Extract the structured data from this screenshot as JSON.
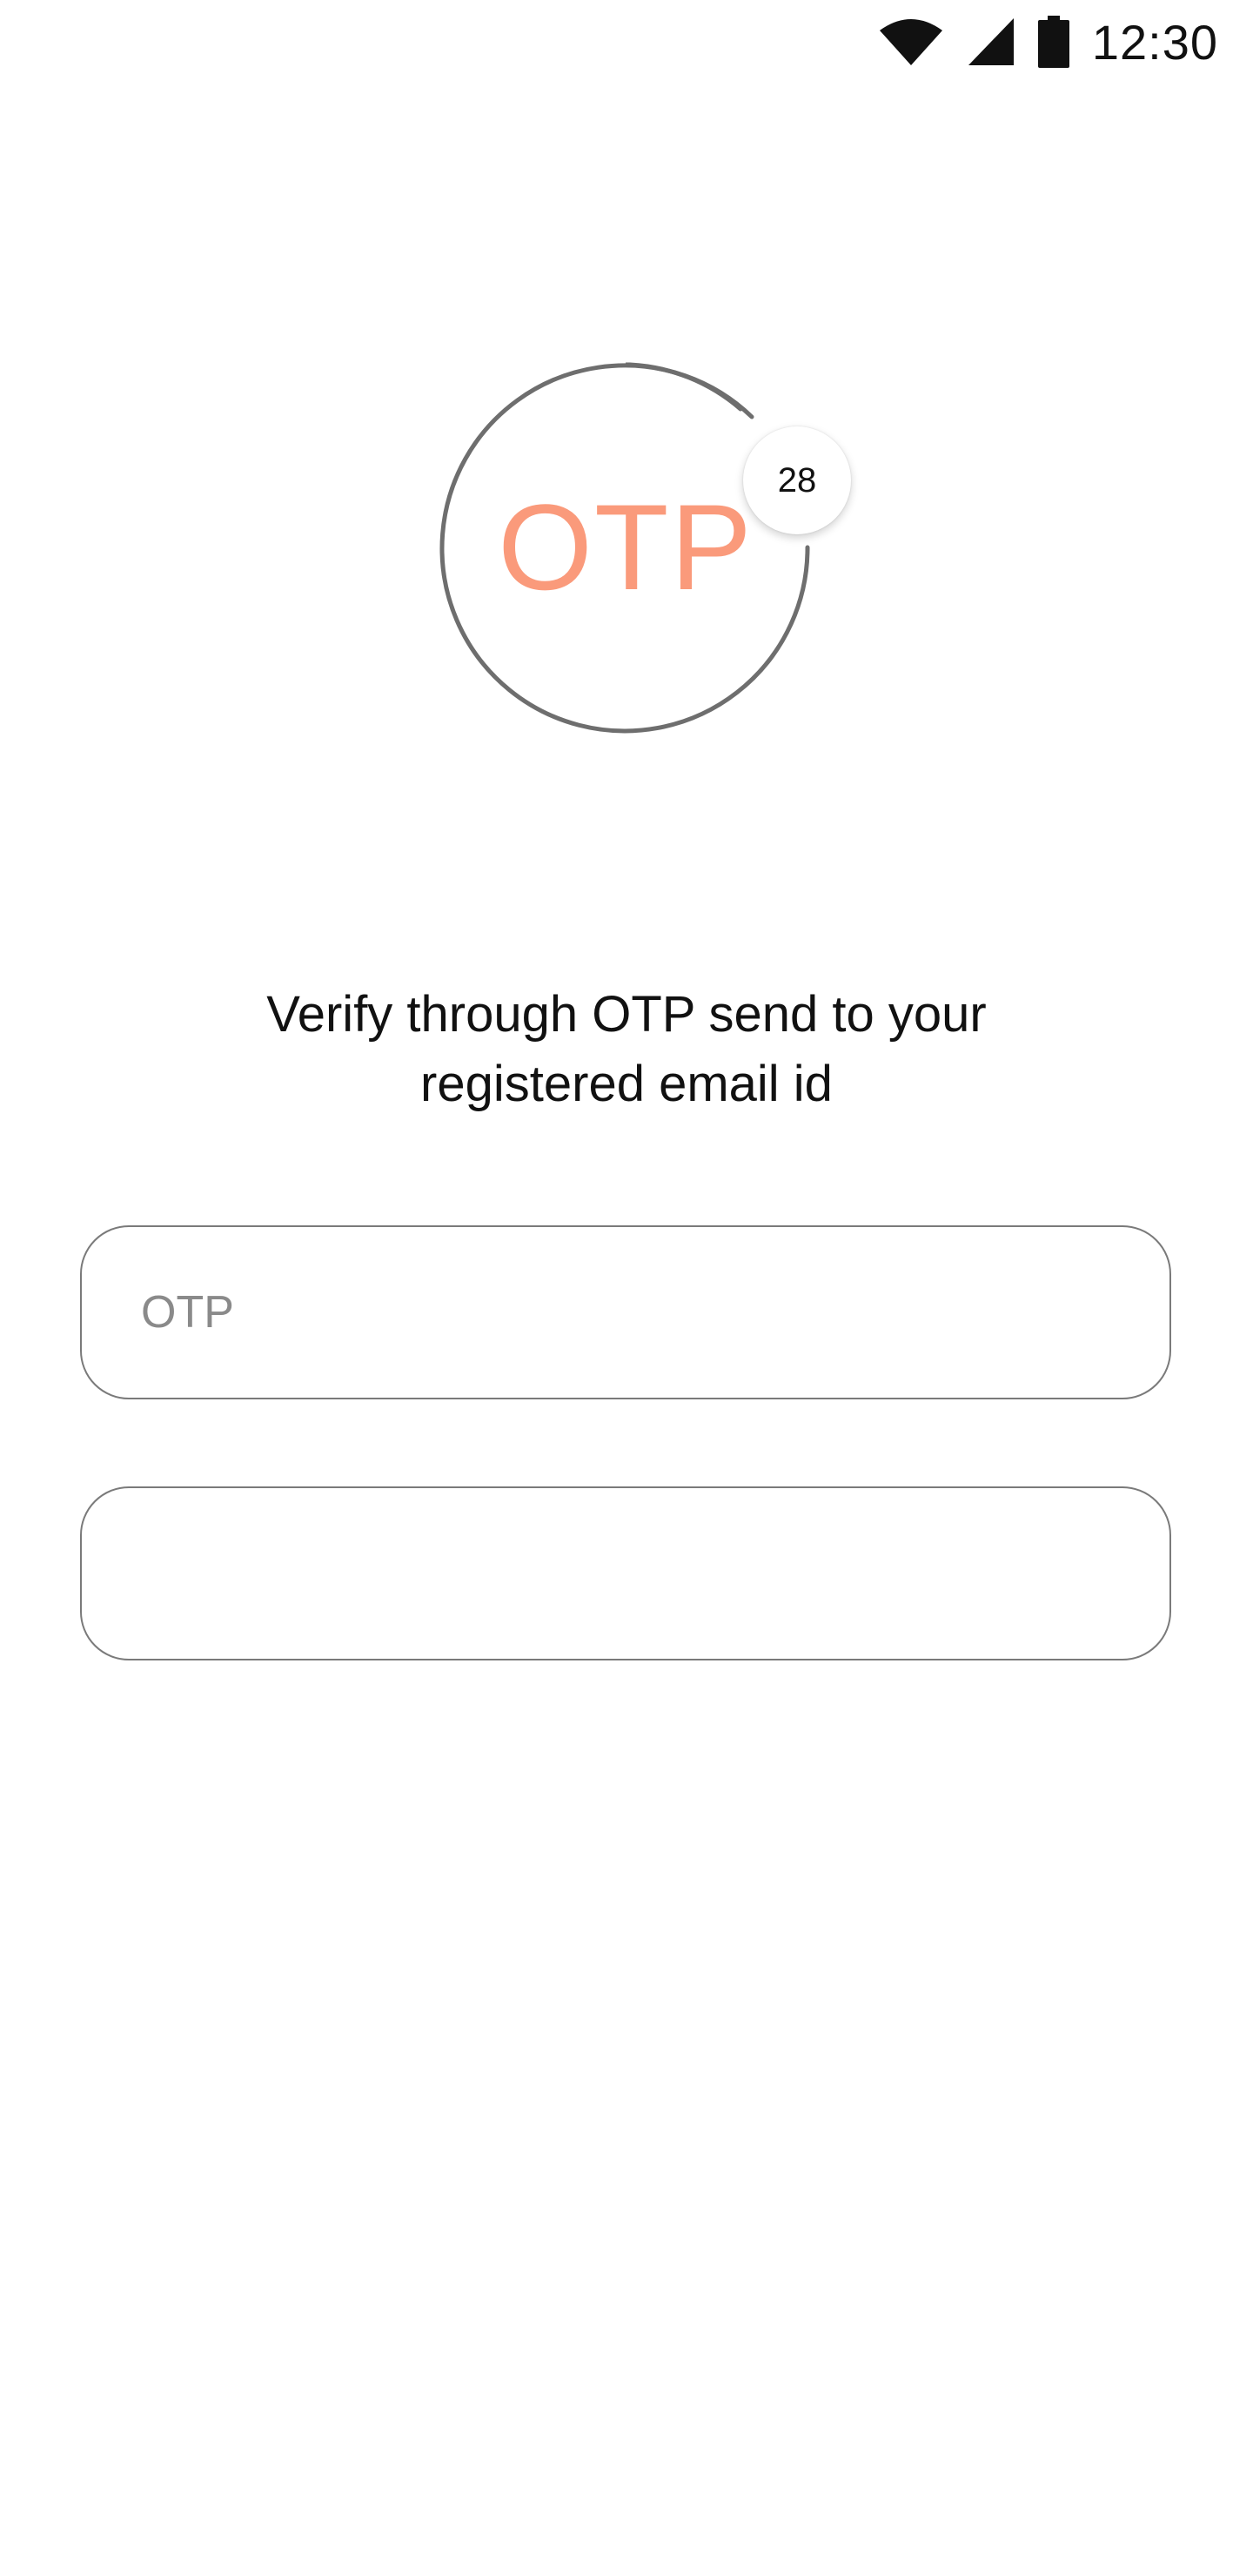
{
  "status_bar": {
    "time": "12:30",
    "icons": [
      "wifi-icon",
      "cellular-signal-icon",
      "battery-icon"
    ]
  },
  "otp_badge": {
    "label": "OTP",
    "timer_seconds": "28",
    "label_color": "#fa9a7b",
    "ring_color": "#6e6e6e"
  },
  "instruction": {
    "line1": "Verify through OTP send to your",
    "line2": "registered email id"
  },
  "otp_input": {
    "placeholder": "OTP",
    "value": ""
  },
  "second_input": {
    "placeholder": "",
    "value": ""
  }
}
